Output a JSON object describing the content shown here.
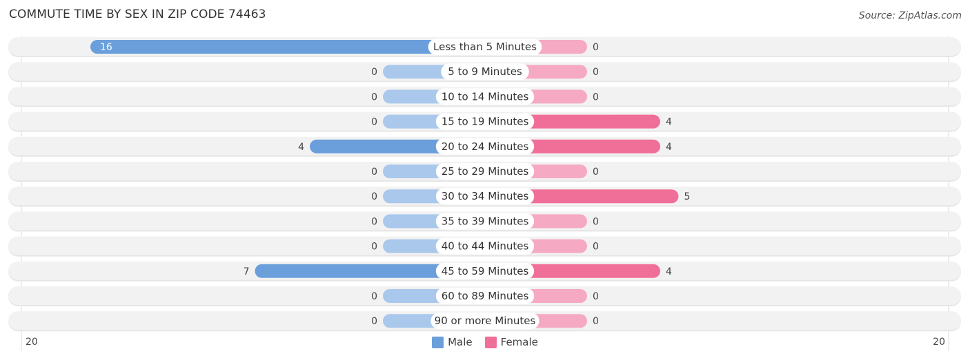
{
  "title": "COMMUTE TIME BY SEX IN ZIP CODE 74463",
  "source": "Source: ZipAtlas.com",
  "colors": {
    "male": "#6a9fdb",
    "male_light": "#a9c8ec",
    "female": "#f06f98",
    "female_light": "#f6a9c2",
    "track": "#f2f2f2"
  },
  "axis": {
    "left_label": "20",
    "right_label": "20"
  },
  "legend": [
    {
      "label": "Male",
      "color": "#6a9fdb"
    },
    {
      "label": "Female",
      "color": "#f06f98"
    }
  ],
  "chart_data": {
    "type": "bar",
    "orientation": "horizontal-diverging",
    "title": "COMMUTE TIME BY SEX IN ZIP CODE 74463",
    "categories": [
      "Less than 5 Minutes",
      "5 to 9 Minutes",
      "10 to 14 Minutes",
      "15 to 19 Minutes",
      "20 to 24 Minutes",
      "25 to 29 Minutes",
      "30 to 34 Minutes",
      "35 to 39 Minutes",
      "40 to 44 Minutes",
      "45 to 59 Minutes",
      "60 to 89 Minutes",
      "90 or more Minutes"
    ],
    "series": [
      {
        "name": "Male",
        "values": [
          16,
          0,
          0,
          0,
          4,
          0,
          0,
          0,
          0,
          7,
          0,
          0
        ]
      },
      {
        "name": "Female",
        "values": [
          0,
          0,
          0,
          4,
          4,
          0,
          5,
          0,
          0,
          4,
          0,
          0
        ]
      }
    ],
    "xlim": [
      -20,
      20
    ],
    "xtick_labels": [
      "20",
      "20"
    ],
    "legend_position": "bottom-center",
    "grid": false
  }
}
